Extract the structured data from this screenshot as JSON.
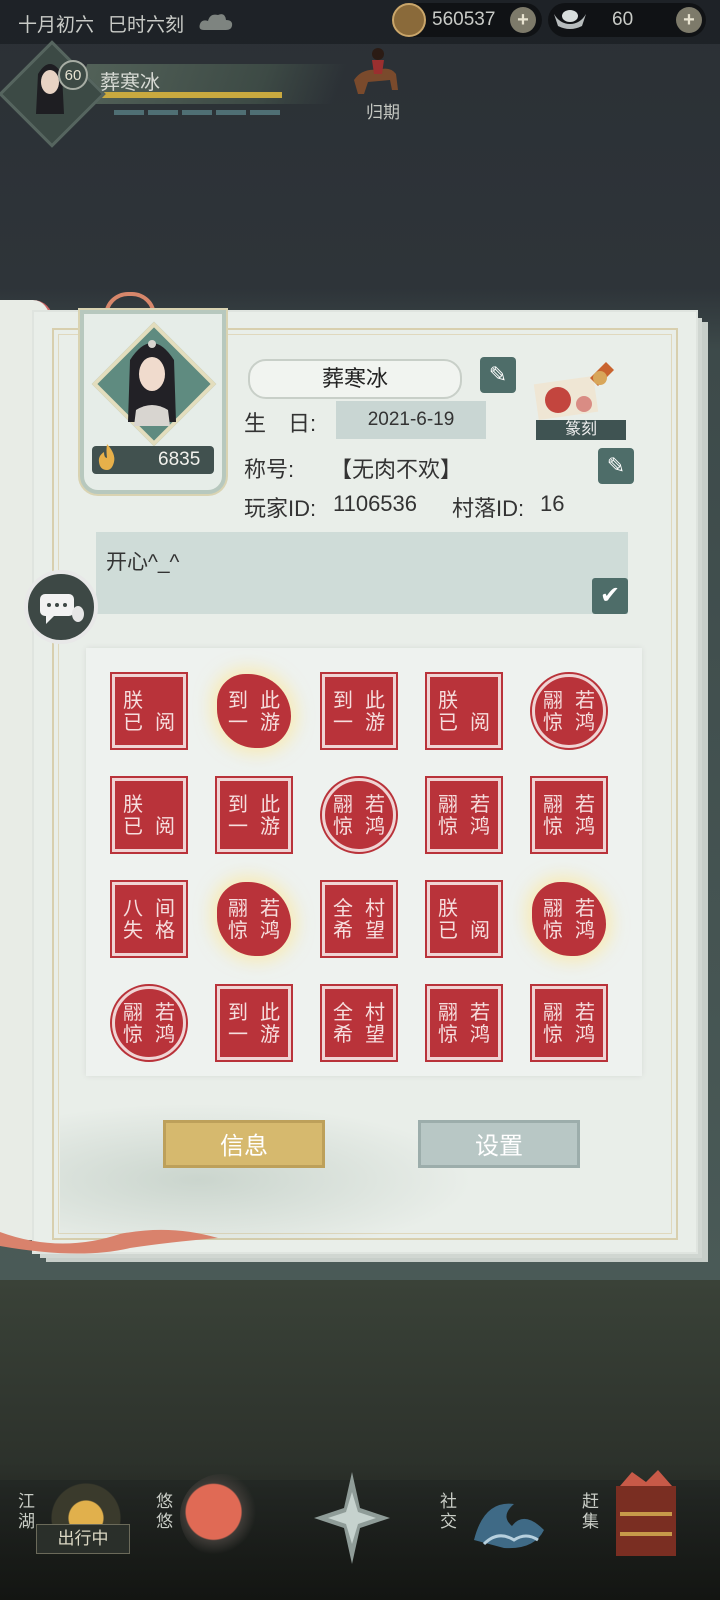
{
  "status_bar": {
    "date": "十月初六",
    "time": "巳时六刻",
    "weather_icon": "cloud-icon",
    "coins": "560537",
    "ingots": "60"
  },
  "player": {
    "level": "60",
    "name": "葬寒冰",
    "companion_label": "归期"
  },
  "profile": {
    "name": "葬寒冰",
    "power": "6835",
    "birthday_label": "生　日:",
    "birthday": "2021-6-19",
    "title_label": "称号:",
    "title": "【无肉不欢】",
    "player_id_label": "玩家ID:",
    "player_id": "1106536",
    "village_id_label": "村落ID:",
    "village_id": "16",
    "seal_carving_label": "篆刻",
    "signature": "开心^_^"
  },
  "seals": [
    {
      "text": [
        "已",
        "朕",
        "阅",
        ""
      ],
      "shape": "square"
    },
    {
      "text": [
        "一",
        "到",
        "游",
        "此"
      ],
      "shape": "blob"
    },
    {
      "text": [
        "一",
        "到",
        "游",
        "此"
      ],
      "shape": "square"
    },
    {
      "text": [
        "已",
        "朕",
        "阅",
        ""
      ],
      "shape": "square"
    },
    {
      "text": [
        "惊",
        "翮",
        "鸿",
        "若"
      ],
      "shape": "round"
    },
    {
      "text": [
        "已",
        "朕",
        "阅",
        ""
      ],
      "shape": "square"
    },
    {
      "text": [
        "一",
        "到",
        "游",
        "此"
      ],
      "shape": "square"
    },
    {
      "text": [
        "惊",
        "翮",
        "鸿",
        "若"
      ],
      "shape": "round"
    },
    {
      "text": [
        "惊",
        "翮",
        "鸿",
        "若"
      ],
      "shape": "square"
    },
    {
      "text": [
        "惊",
        "翮",
        "鸿",
        "若"
      ],
      "shape": "square"
    },
    {
      "text": [
        "失",
        "八",
        "格",
        "间"
      ],
      "shape": "square"
    },
    {
      "text": [
        "惊",
        "翮",
        "鸿",
        "若"
      ],
      "shape": "blob"
    },
    {
      "text": [
        "希",
        "全",
        "望",
        "村"
      ],
      "shape": "square"
    },
    {
      "text": [
        "已",
        "朕",
        "阅",
        ""
      ],
      "shape": "square"
    },
    {
      "text": [
        "惊",
        "翮",
        "鸿",
        "若"
      ],
      "shape": "blob"
    },
    {
      "text": [
        "惊",
        "翮",
        "鸿",
        "若"
      ],
      "shape": "round"
    },
    {
      "text": [
        "一",
        "到",
        "游",
        "此"
      ],
      "shape": "square"
    },
    {
      "text": [
        "希",
        "全",
        "望",
        "村"
      ],
      "shape": "square"
    },
    {
      "text": [
        "惊",
        "翮",
        "鸿",
        "若"
      ],
      "shape": "square"
    },
    {
      "text": [
        "惊",
        "翮",
        "鸿",
        "若"
      ],
      "shape": "square"
    }
  ],
  "buttons": {
    "info": "信息",
    "settings": "设置"
  },
  "bottom_nav": {
    "jianghu": "江湖",
    "travel_status": "出行中",
    "youyou": "悠悠",
    "social": "社交",
    "market": "赶集"
  },
  "colors": {
    "seal_red": "#b9333a",
    "accent_teal": "#4e6d69",
    "gold_button": "#d6b96e"
  }
}
